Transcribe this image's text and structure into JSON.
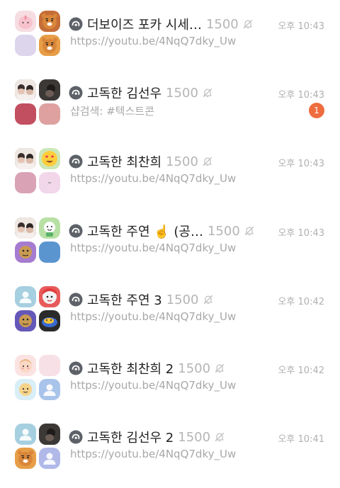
{
  "chats": [
    {
      "title": "더보이즈 포카 시세…",
      "count": "1500",
      "time": "오후 10:43",
      "preview": "https://youtu.be/4NqQ7dky_Uw",
      "avatars": [
        {
          "type": "apeach-character",
          "bg": "#f6dde2"
        },
        {
          "type": "ryan-character",
          "bg": "#c56d37"
        },
        {
          "type": "plain",
          "bg": "#ddd5ec"
        },
        {
          "type": "ryan-character",
          "bg": "#e79e47"
        }
      ]
    },
    {
      "title": "고독한 김선우",
      "count": "1500",
      "time": "오후 10:43",
      "preview": "샵검색: #텍스트콘",
      "badge": "1",
      "avatars": [
        {
          "type": "photo",
          "bg": "#6b5b55"
        },
        {
          "type": "photo-dark",
          "bg": "#3b3838"
        },
        {
          "type": "plain",
          "bg": "#c24f5f"
        },
        {
          "type": "plain",
          "bg": "#dea19f"
        }
      ]
    },
    {
      "title": "고독한 최찬희",
      "count": "1500",
      "time": "오후 10:43",
      "preview": "https://youtu.be/4NqQ7dky_Uw",
      "avatars": [
        {
          "type": "photo",
          "bg": "#7a6d6a"
        },
        {
          "type": "heart-eyes-emoji",
          "bg": "#cce7b7"
        },
        {
          "type": "plain",
          "bg": "#d9a2b5"
        },
        {
          "type": "dash",
          "bg": "#f2d6ea"
        }
      ]
    },
    {
      "title": "고독한 주연 ☝️ (공…",
      "count": "1500",
      "time": "오후 10:43",
      "preview": "https://youtu.be/4NqQ7dky_Uw",
      "avatars": [
        {
          "type": "photo",
          "bg": "#6c6060"
        },
        {
          "type": "cartoon-green",
          "bg": "#b8e0a4"
        },
        {
          "type": "cartoon-purple",
          "bg": "#a57ccf"
        },
        {
          "type": "plain",
          "bg": "#5b95d0"
        }
      ]
    },
    {
      "title": "고독한 주연 3",
      "count": "1500",
      "time": "오후 10:42",
      "preview": "https://youtu.be/4NqQ7dky_Uw",
      "avatars": [
        {
          "type": "default-person",
          "bg": "#a6cfe0"
        },
        {
          "type": "cartoon-red",
          "bg": "#e85a5a"
        },
        {
          "type": "cartoon-purple",
          "bg": "#6557b8"
        },
        {
          "type": "cartoon-dark",
          "bg": "#2a2a2a"
        }
      ]
    },
    {
      "title": "고독한 최찬희 2",
      "count": "1500",
      "time": "오후 10:42",
      "preview": "https://youtu.be/4NqQ7dky_Uw",
      "avatars": [
        {
          "type": "cartoon-face",
          "bg": "#fbe3e3"
        },
        {
          "type": "plain",
          "bg": "#f7e1e6"
        },
        {
          "type": "cartoon-light",
          "bg": "#d9eef7"
        },
        {
          "type": "default-person",
          "bg": "#a9c4ea"
        }
      ]
    },
    {
      "title": "고독한 김선우 2",
      "count": "1500",
      "time": "오후 10:41",
      "preview": "https://youtu.be/4NqQ7dky_Uw",
      "avatars": [
        {
          "type": "default-person",
          "bg": "#a6cfe0"
        },
        {
          "type": "photo-dark",
          "bg": "#4a4544"
        },
        {
          "type": "ryan-character",
          "bg": "#e79e47"
        },
        {
          "type": "default-person",
          "bg": "#b0b9e8"
        }
      ]
    }
  ],
  "colors": {
    "title": "#222222",
    "count": "#b5b5b5",
    "time": "#b0b0b0",
    "preview": "#a8a8a8",
    "badge": "#ee6c3e"
  },
  "icons": {
    "chat-type": "open-chat-icon",
    "mute": "bell-off-icon"
  }
}
